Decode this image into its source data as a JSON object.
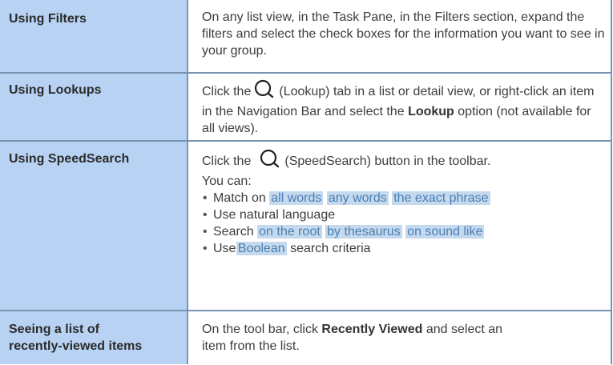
{
  "rows": [
    {
      "term": "Using Filters",
      "desc": "On any list view, in the Task Pane, in the Filters section, expand the filters and select the check boxes for the information you want to see in your group."
    },
    {
      "term": "Using Lookups",
      "desc_before_icon": "Click the",
      "desc_after_icon": "(Lookup) tab in a list or detail view, or right-click an item in the Navigation Bar and select the",
      "desc_bold": "Lookup",
      "desc_end": "option (not available for all views).",
      "icon": "magnifier-icon"
    },
    {
      "term": "Using SpeedSearch",
      "desc_before_icon": "Click the",
      "desc_after_icon": "(SpeedSearch) button in the toolbar.",
      "desc_line2": "You can:",
      "icon": "magnifier-icon",
      "bullets": {
        "match_prefix": "Match on",
        "match_options": [
          "all words",
          "any words",
          "the exact phrase"
        ],
        "natural": "Use natural language",
        "search_prefix": "Search",
        "search_options": [
          "on the root",
          "by thesaurus",
          "on sound like"
        ],
        "boolean_prefix": "Use",
        "boolean_option": "Boolean",
        "boolean_suffix": "search criteria"
      }
    },
    {
      "term_line1": "Seeing a list of",
      "term_line2": "recently-viewed items",
      "desc_prefix": "On the tool bar, click",
      "desc_bold": "Recently Viewed",
      "desc_suffix": "and select an",
      "desc_line2": "item from the list."
    }
  ],
  "colors": {
    "term_bg": "#b7d2f2",
    "border": "#7a93b3",
    "option_highlight_bg": "#c5d9ee",
    "option_text": "#4a7fb3"
  }
}
